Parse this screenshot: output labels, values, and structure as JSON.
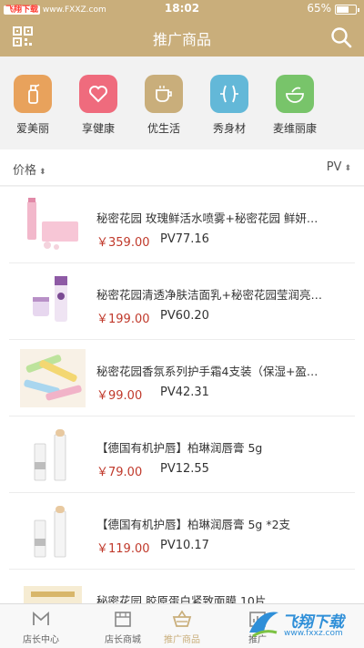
{
  "status": {
    "carrier_prefix": "飞翔下载",
    "carrier_url": "www.FXXZ.com",
    "time": "18:02",
    "battery": "65%"
  },
  "navbar": {
    "title": "推广商品"
  },
  "categories": [
    {
      "label": "爱美丽",
      "color": "#e8a25c"
    },
    {
      "label": "享健康",
      "color": "#ef6b7d"
    },
    {
      "label": "优生活",
      "color": "#c9ae7b"
    },
    {
      "label": "秀身材",
      "color": "#63b8d8"
    },
    {
      "label": "麦维丽康",
      "color": "#78c46a"
    }
  ],
  "sort": {
    "price_label": "价格",
    "pv_label": "PV"
  },
  "products": [
    {
      "name": "秘密花园 玫瑰鲜活水喷雾+秘密花园 鲜妍…",
      "price": "￥359.00",
      "pv": "PV77.16"
    },
    {
      "name": "秘密花园清透净肤洁面乳+秘密花园莹润亮…",
      "price": "￥199.00",
      "pv": "PV60.20"
    },
    {
      "name": "秘密花园香氛系列护手霜4支装（保湿+盈…",
      "price": "￥99.00",
      "pv": "PV42.31"
    },
    {
      "name": "【德国有机护唇】柏琳润唇膏 5g",
      "price": "￥79.00",
      "pv": "PV12.55"
    },
    {
      "name": "【德国有机护唇】柏琳润唇膏 5g *2支",
      "price": "￥119.00",
      "pv": "PV10.17"
    },
    {
      "name": "秘密花园 胶原蛋白紧致面膜 10片",
      "price": "",
      "pv": ""
    }
  ],
  "tabs": [
    {
      "label": "店长中心"
    },
    {
      "label": "店长商城"
    },
    {
      "label": "推广商品"
    },
    {
      "label": "推广"
    }
  ],
  "watermark": {
    "text": "飞翔下载",
    "url": "www.fxxz.com"
  }
}
